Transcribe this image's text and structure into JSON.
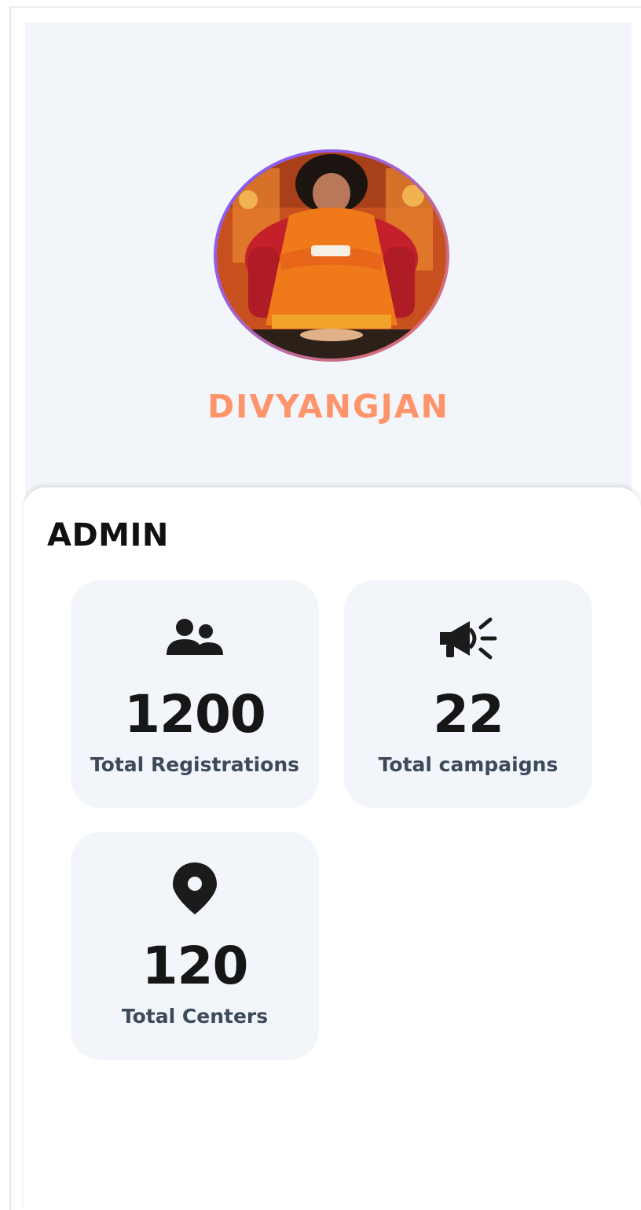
{
  "app": {
    "brand_name": "DIVYANGJAN",
    "brand_color": "#ff946a",
    "avatar_icon": "profile-photo"
  },
  "section": {
    "title": "ADMIN"
  },
  "stats": [
    {
      "icon": "users-icon",
      "value": "1200",
      "label": "Total Registrations"
    },
    {
      "icon": "megaphone-icon",
      "value": "22",
      "label": "Total campaigns"
    },
    {
      "icon": "location-pin-icon",
      "value": "120",
      "label": "Total Centers"
    }
  ],
  "colors": {
    "hero_background": "#f2f5fa",
    "card_background": "#f2f5fa",
    "value_text": "#161616",
    "label_text": "#3c4a5a"
  }
}
